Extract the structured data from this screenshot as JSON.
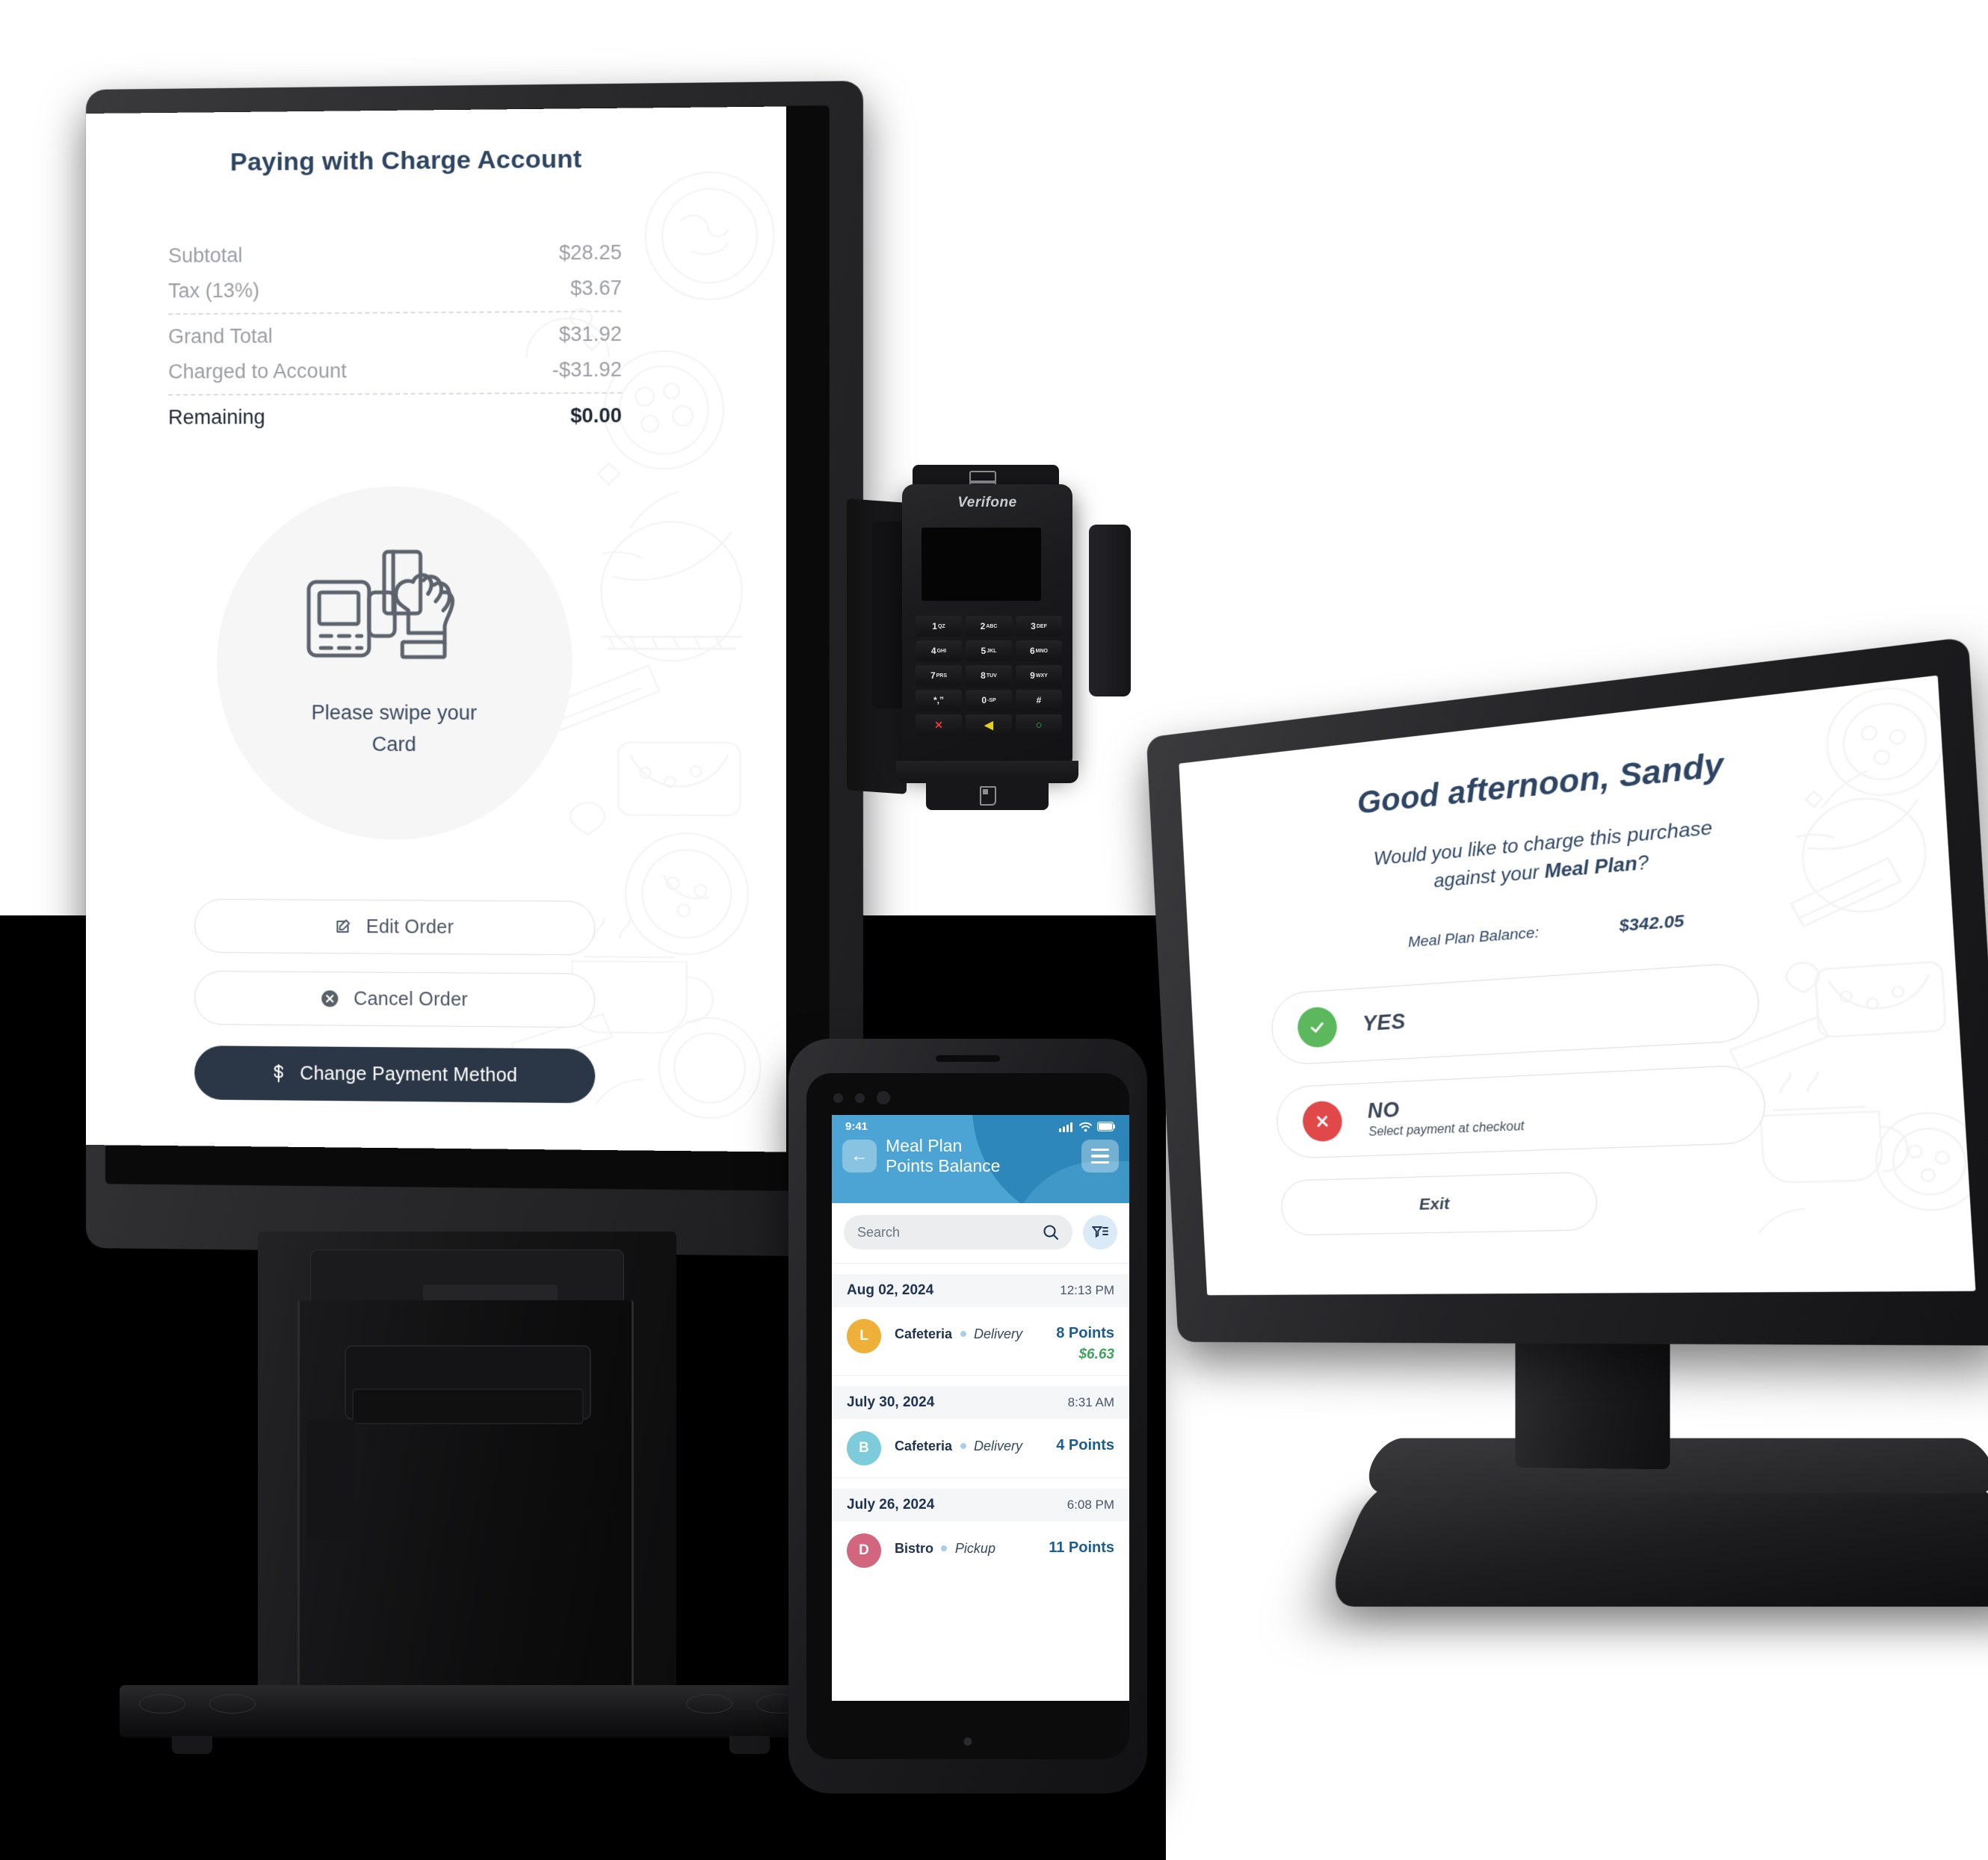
{
  "backdrop": {
    "color": "#000000"
  },
  "pos_terminal": {
    "device_name": "pos-upright-touchscreen",
    "screen": {
      "title": "Paying with Charge Account",
      "receipt": {
        "rows": [
          {
            "label": "Subtotal",
            "value": "$28.25",
            "emphasis": false
          },
          {
            "label": "Tax (13%)",
            "value": "$3.67",
            "emphasis": false
          },
          {
            "label": "Grand Total",
            "value": "$31.92",
            "emphasis": false
          },
          {
            "label": "Charged to Account",
            "value": "-$31.92",
            "emphasis": false
          },
          {
            "label": "Remaining",
            "value": "$0.00",
            "emphasis": true
          }
        ]
      },
      "prompt": {
        "icon": "card-swipe-terminal-icon",
        "line1": "Please swipe your",
        "line2": "Card"
      },
      "actions": [
        {
          "label": "Edit Order",
          "icon": "edit-pencil-icon",
          "style": "outline"
        },
        {
          "label": "Cancel Order",
          "icon": "close-circle-icon",
          "style": "outline"
        },
        {
          "label": "Change Payment Method",
          "icon": "dollar-sign-icon",
          "style": "filled"
        }
      ],
      "colors": {
        "heading": "#2d4562",
        "filled_button": "#2b3647",
        "muted_text": "#9b9ea4"
      }
    }
  },
  "pin_pad": {
    "device_name": "verifone-pin-pad",
    "brand": "Verifone",
    "display_state": "off",
    "keys": [
      {
        "digit": "1",
        "letters": "QZ"
      },
      {
        "digit": "2",
        "letters": "ABC"
      },
      {
        "digit": "3",
        "letters": "DEF"
      },
      {
        "digit": "4",
        "letters": "GHI"
      },
      {
        "digit": "5",
        "letters": "JKL"
      },
      {
        "digit": "6",
        "letters": "MNO"
      },
      {
        "digit": "7",
        "letters": "PRS"
      },
      {
        "digit": "8",
        "letters": "TUV"
      },
      {
        "digit": "9",
        "letters": "WXY"
      },
      {
        "digit": "*,”",
        "letters": ""
      },
      {
        "digit": "0",
        "letters": "-SP"
      },
      {
        "digit": "#",
        "letters": ""
      }
    ],
    "function_keys": [
      {
        "glyph": "✕",
        "name": "cancel-key",
        "color": "#e03a3a"
      },
      {
        "glyph": "◀",
        "name": "backspace-key",
        "color": "#e8d014"
      },
      {
        "glyph": "○",
        "name": "enter-key",
        "color": "#30c44a"
      }
    ]
  },
  "handheld": {
    "device_name": "handheld-mobile-terminal",
    "status_bar": {
      "time": "9:41",
      "signal": "cellular-signal-icon",
      "wifi": "wifi-icon",
      "battery": "battery-full-icon"
    },
    "header": {
      "back_icon": "arrow-left-icon",
      "title_line1": "Meal Plan",
      "title_line2": "Points Balance",
      "menu_icon": "hamburger-menu-icon",
      "bg_color": "#4ba4d4"
    },
    "search": {
      "placeholder": "Search",
      "icon": "search-icon",
      "filter_icon": "filter-funnel-icon"
    },
    "groups": [
      {
        "date": "Aug 02, 2024",
        "time": "12:13 PM",
        "transactions": [
          {
            "initial": "L",
            "avatar_color": "#efb03a",
            "merchant": "Cafeteria",
            "mode": "Delivery",
            "points": "8 Points",
            "amount": "$6.63"
          }
        ]
      },
      {
        "date": "July 30, 2024",
        "time": "8:31 AM",
        "transactions": [
          {
            "initial": "B",
            "avatar_color": "#7ecbdc",
            "merchant": "Cafeteria",
            "mode": "Delivery",
            "points": "4 Points",
            "amount": ""
          }
        ]
      },
      {
        "date": "July 26, 2024",
        "time": "6:08 PM",
        "transactions": [
          {
            "initial": "D",
            "avatar_color": "#d2667f",
            "merchant": "Bistro",
            "mode": "Pickup",
            "points": "11 Points",
            "amount": ""
          }
        ]
      }
    ],
    "colors": {
      "points": "#1c5d8f",
      "amount": "#3fa35e",
      "heading": "#1f3350"
    }
  },
  "customer_display": {
    "device_name": "customer-facing-display",
    "greeting": "Good afternoon, Sandy",
    "question_line1": "Would you like to charge this purchase",
    "question_line2_prefix": "against your ",
    "question_line2_bold": "Meal Plan",
    "question_line2_suffix": "?",
    "balance_label": "Meal Plan Balance:",
    "balance_value": "$342.05",
    "options": [
      {
        "label": "YES",
        "sublabel": "",
        "icon": "check-circle-icon",
        "color": "#5cb85c"
      },
      {
        "label": "NO",
        "sublabel": "Select payment at checkout",
        "icon": "close-circle-icon",
        "color": "#e0484a"
      }
    ],
    "exit_label": "Exit",
    "colors": {
      "heading": "#2d4562"
    }
  }
}
